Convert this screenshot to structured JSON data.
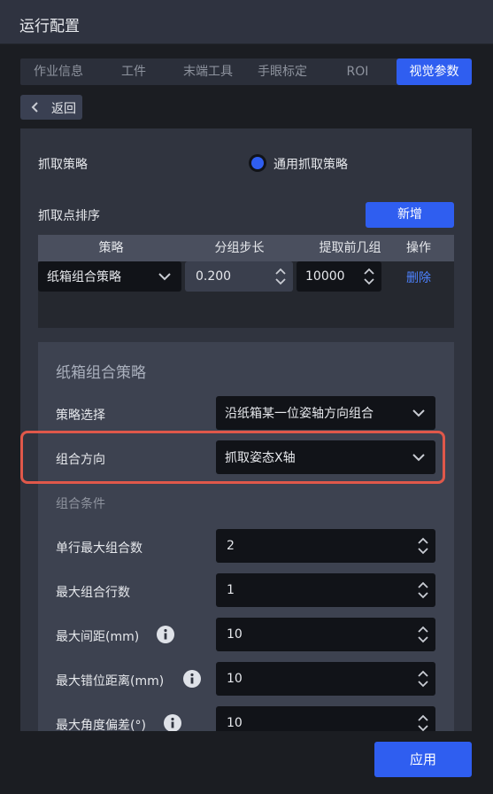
{
  "window": {
    "title": "运行配置"
  },
  "tabs": [
    {
      "label": "作业信息",
      "active": false
    },
    {
      "label": "工件",
      "active": false
    },
    {
      "label": "末端工具",
      "active": false
    },
    {
      "label": "手眼标定",
      "active": false
    },
    {
      "label": "ROI",
      "active": false
    },
    {
      "label": "视觉参数",
      "active": true
    }
  ],
  "back_button": {
    "label": "返回",
    "icon": "chevron-left-icon"
  },
  "grab_strategy": {
    "label": "抓取策略",
    "option_label": "通用抓取策略",
    "selected": true
  },
  "sort": {
    "label": "抓取点排序",
    "add_button": "新增",
    "columns": [
      "策略",
      "分组步长",
      "提取前几组",
      "操作"
    ],
    "rows": [
      {
        "strategy": "纸箱组合策略",
        "step": "0.200",
        "first_n": "10000",
        "action": "删除"
      }
    ]
  },
  "carton": {
    "title": "纸箱组合策略",
    "strategy_select": {
      "label": "策略选择",
      "value": "沿纸箱某一位姿轴方向组合"
    },
    "direction": {
      "label": "组合方向",
      "value": "抓取姿态X轴"
    },
    "conditions_title": "组合条件",
    "fields": [
      {
        "label": "单行最大组合数",
        "value": "2",
        "info": false
      },
      {
        "label": "最大组合行数",
        "value": "1",
        "info": false
      },
      {
        "label": "最大间距(mm)",
        "value": "10",
        "info": true
      },
      {
        "label": "最大错位距离(mm)",
        "value": "10",
        "info": true
      },
      {
        "label": "最大角度偏差(°)",
        "value": "10",
        "info": true
      }
    ]
  },
  "apply_button": {
    "label": "应用"
  },
  "colors": {
    "accent": "#2f5ef0",
    "highlight_border": "#e0584a",
    "link": "#4d82ff"
  }
}
